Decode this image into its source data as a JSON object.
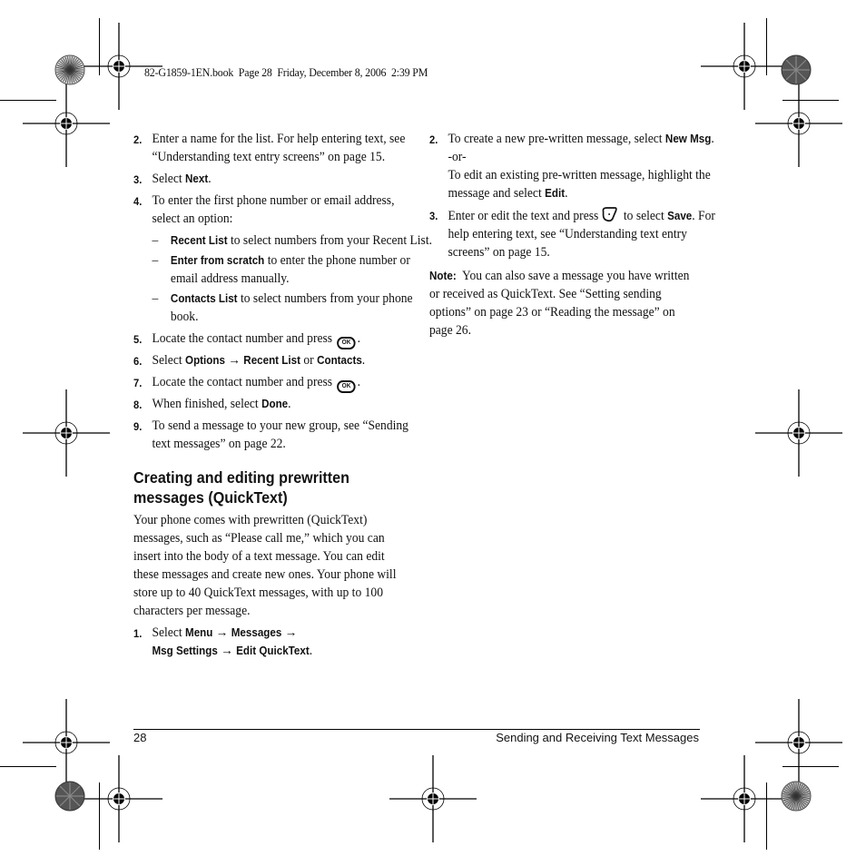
{
  "slug_line": "82-G1859-1EN.book  Page 28  Friday, December 8, 2006  2:39 PM",
  "left_column": {
    "steps_a": [
      {
        "num": "2.",
        "text": "Enter a name for the list. For help entering text, see “Understanding text entry screens” on page 15."
      },
      {
        "num": "3.",
        "pre": "Select ",
        "bold": "Next",
        "post": "."
      },
      {
        "num": "4.",
        "text": "To enter the first phone number or email address, select an option:"
      }
    ],
    "options": [
      {
        "dash": "–",
        "bold": "Recent List",
        "text": " to select numbers from your Recent List."
      },
      {
        "dash": "–",
        "bold": "Enter from scratch",
        "text": " to enter the phone number or email address manually."
      },
      {
        "dash": "–",
        "bold": "Contacts List",
        "text": " to select numbers from your phone book."
      }
    ],
    "step5": {
      "num": "5.",
      "text": "Locate the contact number and press",
      "key": "OK",
      "post": "."
    },
    "step6": {
      "num": "6.",
      "pre": "Select ",
      "b1": "Options",
      "arrow": " → ",
      "b2": "Recent List",
      "mid": " or ",
      "b3": "Contacts",
      "post": "."
    },
    "step7": {
      "num": "7.",
      "text": "Locate the contact number and press",
      "key": "OK",
      "post": "."
    },
    "step8": {
      "num": "8.",
      "pre": "When finished, select ",
      "bold": "Done",
      "post": "."
    },
    "step9": {
      "num": "9.",
      "text": "To send a message to your new group, see “Sending text messages” on page 22."
    },
    "heading": "Creating and editing prewritten messages (QuickText)",
    "intro": "Your phone comes with prewritten (QuickText) messages, such as “Please call me,” which you can insert into the body of a text message. You can edit these messages and create new ones. Your phone will store up to 40 QuickText messages, with up to 100 characters per message.",
    "step1": {
      "num": "1.",
      "pre": "Select ",
      "b1": "Menu",
      "a1": " → ",
      "b2": "Messages",
      "a2": " →",
      "b3": "Msg Settings",
      "a3": " → ",
      "b4": "Edit QuickText",
      "post": "."
    }
  },
  "right_column": {
    "step2": {
      "num": "2.",
      "pre": "To create a new pre-written message, select ",
      "bold": "New Msg",
      "post": ".",
      "or": "-or-",
      "alt_pre": "To edit an existing pre-written message, highlight the message and select ",
      "alt_bold": "Edit",
      "alt_post": "."
    },
    "step3": {
      "num": "3.",
      "pre": "Enter or edit the text and press",
      "key_icon": "right-softkey-icon",
      "mid": " to select ",
      "bold": "Save",
      "post": ". For help entering text, see “Understanding text entry screens” on page 15."
    },
    "note": {
      "label": "Note:",
      "text": "You can also save a message you have written or received as QuickText. See “Setting sending options” on page 23 or “Reading the message” on page 26."
    }
  },
  "footer": {
    "page_number": "28",
    "section_title": "Sending and Receiving Text Messages"
  }
}
